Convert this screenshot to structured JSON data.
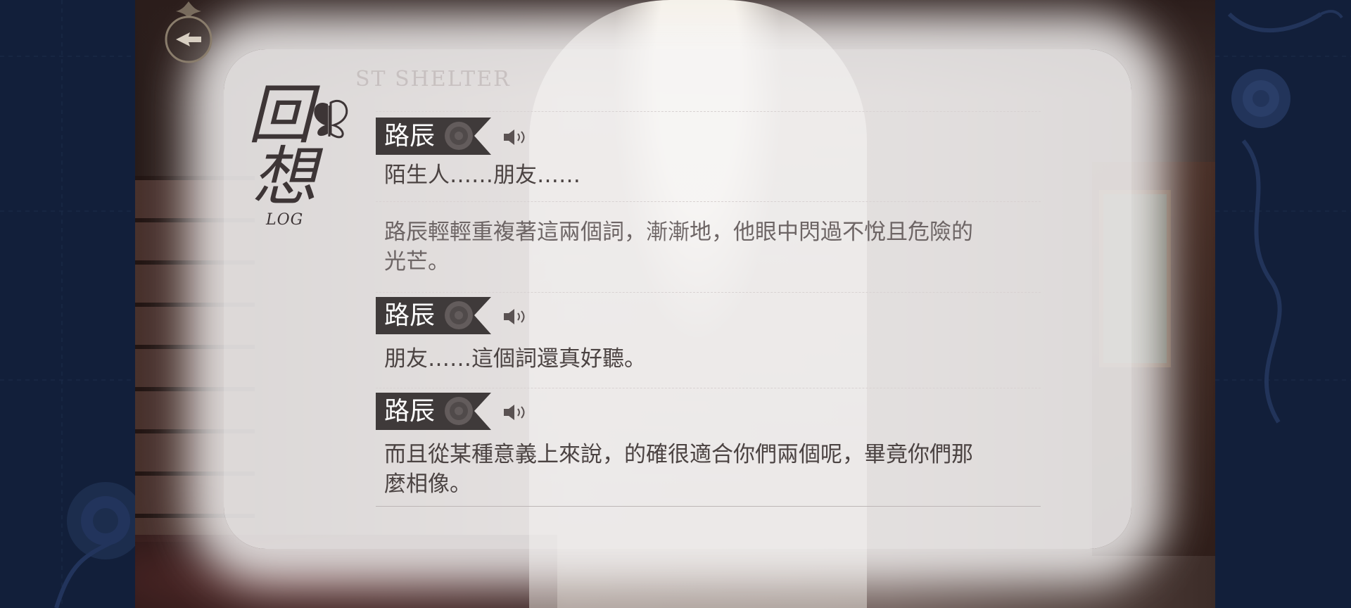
{
  "watermark": "ST SHELTER",
  "log_title": {
    "kanji_top": "回",
    "kanji_bottom": "想",
    "subtitle": "LOG"
  },
  "entries": [
    {
      "type": "speech",
      "speaker": "路辰",
      "text": "陌生人……朋友……"
    },
    {
      "type": "narration",
      "text_line1": "路辰輕輕重複著這兩個詞，漸漸地，他眼中閃過不悅且危險的",
      "text_line2": "光芒。"
    },
    {
      "type": "speech",
      "speaker": "路辰",
      "text": "朋友……這個詞還真好聽。"
    },
    {
      "type": "speech",
      "speaker": "路辰",
      "text_line1": "而且從某種意義上來說，的確很適合你們兩個呢，畢竟你們那",
      "text_line2": "麼相像。"
    }
  ],
  "icons": {
    "back": "back-arrow-icon",
    "voice": "speaker-icon",
    "rose": "rose-icon",
    "butterfly": "butterfly-icon"
  },
  "colors": {
    "name_tag": "#3f3a3a",
    "side_panel": "#121f3a",
    "text": "#4b4342"
  }
}
